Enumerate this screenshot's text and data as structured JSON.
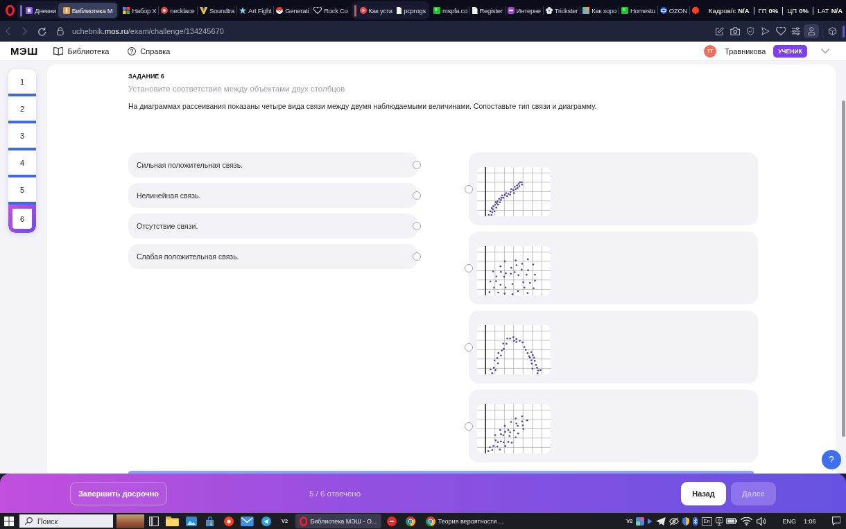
{
  "browser": {
    "tab_groups": [
      {
        "color": "#7b5cf7",
        "tabs": [
          {
            "title": "Дневни",
            "kind": "diary",
            "selected": false
          },
          {
            "title": "Библиотека М",
            "kind": "library",
            "selected": true
          }
        ]
      },
      {
        "tabs": [
          {
            "title": "Набор Х",
            "kind": "google",
            "selected": false
          },
          {
            "title": "necklace",
            "kind": "necklace",
            "selected": false
          },
          {
            "title": "Soundtra",
            "kind": "soundtrack",
            "selected": false
          },
          {
            "title": "Art Fight",
            "kind": "star",
            "selected": false
          },
          {
            "title": "Generati",
            "kind": "ball",
            "selected": false
          },
          {
            "title": "Rock Co",
            "kind": "heart",
            "selected": false
          }
        ]
      },
      {
        "color": "#e5505d",
        "tabs": [
          {
            "title": "Как уста",
            "kind": "play",
            "selected": false
          },
          {
            "title": "pcprogs",
            "kind": "document",
            "selected": false
          }
        ]
      },
      {
        "tabs": [
          {
            "title": "mspfa.co",
            "kind": "cube",
            "selected": false
          },
          {
            "title": "Register",
            "kind": "document",
            "selected": false
          },
          {
            "title": "Интерне",
            "kind": "wb",
            "selected": false
          },
          {
            "title": "Trickster",
            "kind": "flower",
            "selected": false
          },
          {
            "title": "Как хоро",
            "kind": "mosaic",
            "selected": false
          },
          {
            "title": "Homestu",
            "kind": "cube",
            "selected": false
          },
          {
            "title": "OZON",
            "kind": "ring",
            "selected": false
          },
          {
            "kind": "dot",
            "selected": false
          }
        ]
      }
    ],
    "performance_overlay": [
      {
        "label": "Кадров/с",
        "value": "N/A"
      },
      {
        "label": "ГП",
        "value": "0%"
      },
      {
        "label": "ЦП",
        "value": "0%"
      },
      {
        "label": "LAT",
        "value": "N/A"
      }
    ],
    "address_bar": {
      "nav_buttons": [
        {
          "kind": "back",
          "disabled": true
        },
        {
          "kind": "forward",
          "disabled": true
        },
        {
          "kind": "reload",
          "disabled": false
        }
      ],
      "url": "uchebnik.**mos.ru**/exam/challenge/134245670"
    },
    "toolbar": [
      {
        "kind": "edit",
        "selected": false
      },
      {
        "kind": "camera",
        "selected": false
      },
      {
        "kind": "shield",
        "selected": false
      },
      {
        "kind": "send",
        "selected": false
      },
      {
        "kind": "heart",
        "selected": false
      },
      {
        "kind": "sliders",
        "selected": false
      },
      {
        "kind": "profile",
        "selected": true
      },
      {
        "kind": "extensions",
        "selected": false
      }
    ]
  },
  "page": {
    "header": {
      "logo": "МЭШ",
      "links": [
        {
          "kind": "book",
          "label": "Библиотека"
        },
        {
          "kind": "help",
          "label": "Справка"
        }
      ],
      "user": {
        "initials": "ТТ",
        "name": "Травникова",
        "role": "УЧЕНИК"
      }
    },
    "question_nav": [
      {
        "label": "1",
        "answered": true,
        "selected": false
      },
      {
        "label": "2",
        "answered": true,
        "selected": false
      },
      {
        "label": "3",
        "answered": true,
        "selected": false
      },
      {
        "label": "4",
        "answered": true,
        "selected": false
      },
      {
        "label": "5",
        "answered": true,
        "selected": false
      },
      {
        "label": "6",
        "answered": false,
        "selected": true
      }
    ],
    "task": {
      "heading": "ЗАДАНИЕ 6",
      "instruction": "Установите соответствие между объектами двух столбцов",
      "text": "На диаграммах рассеивания показаны четыре вида связи между двумя наблюдаемыми величинами. Сопоставьте тип связи и диаграмму."
    },
    "left_options": [
      {
        "label": "Сильная положительная связь.",
        "selected": false
      },
      {
        "label": "Нелинейная связь.",
        "selected": false
      },
      {
        "label": "Отсутствие связи.",
        "selected": false
      },
      {
        "label": "Слабая положительная связь.",
        "selected": false
      }
    ],
    "right_options": [
      {
        "kind": "curve",
        "selected": false
      },
      {
        "kind": "cloud",
        "selected": false
      },
      {
        "kind": "arch",
        "selected": false
      },
      {
        "kind": "band",
        "selected": false
      }
    ],
    "help_button": "?",
    "footer": {
      "finish_button": "Завершить досрочно",
      "progress": "5 / 6 отвечено",
      "back_button": {
        "label": "Назад",
        "disabled": false
      },
      "next_button": {
        "label": "Далее",
        "disabled": true
      }
    }
  },
  "taskbar": {
    "search": {
      "placeholder": "Поиск"
    },
    "apps": [
      {
        "kind": "taskview",
        "selected": false
      },
      {
        "kind": "folder",
        "selected": false
      },
      {
        "kind": "photos",
        "selected": false
      },
      {
        "kind": "store",
        "selected": false
      },
      {
        "kind": "yandex",
        "selected": false
      },
      {
        "kind": "mail",
        "selected": false
      },
      {
        "kind": "telegram",
        "selected": false
      },
      {
        "kind": "label",
        "label": "V2",
        "selected": false
      },
      {
        "kind": "opera",
        "title": "Библиотека МЭШ - О...",
        "selected": true
      },
      {
        "kind": "record",
        "selected": false
      },
      {
        "kind": "chrome",
        "selected": false
      },
      {
        "kind": "chrome",
        "title": "Теория вероятности ...",
        "selected": false
      }
    ],
    "tray": [
      {
        "kind": "label",
        "label": "V2"
      },
      {
        "kind": "mosaic"
      },
      {
        "kind": "caret"
      },
      {
        "kind": "plane"
      },
      {
        "kind": "eyeoff"
      },
      {
        "kind": "shield"
      },
      {
        "kind": "bluetooth"
      },
      {
        "kind": "badge",
        "label": "En"
      },
      {
        "kind": "webcam"
      },
      {
        "kind": "battery"
      },
      {
        "kind": "wifi"
      },
      {
        "kind": "speaker"
      }
    ],
    "language": "ENG",
    "time": "1:06"
  }
}
